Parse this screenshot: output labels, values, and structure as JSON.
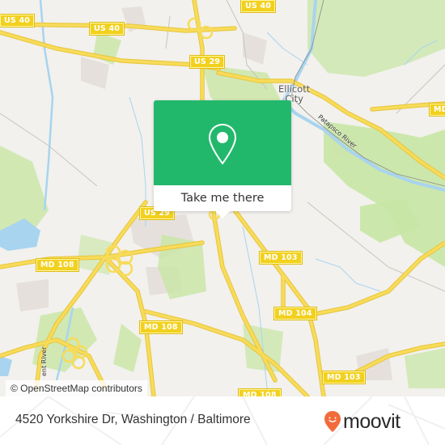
{
  "map": {
    "attribution": "© OpenStreetMap contributors",
    "place_labels": [
      {
        "id": "ellicott-city",
        "line1": "Ellicott",
        "line2": "City"
      }
    ],
    "river_labels": [
      {
        "id": "patapsco-river",
        "text": "Patapsco River"
      },
      {
        "id": "patuxent-river",
        "text": "ent River"
      }
    ],
    "road_shields": [
      {
        "id": "us40-a",
        "text": "US 40"
      },
      {
        "id": "us40-b",
        "text": "US 40"
      },
      {
        "id": "us40-c",
        "text": "US 40"
      },
      {
        "id": "us29-a",
        "text": "US 29"
      },
      {
        "id": "us29-b",
        "text": "US 29"
      },
      {
        "id": "md108-a",
        "text": "MD 108"
      },
      {
        "id": "md108-b",
        "text": "MD 108"
      },
      {
        "id": "md108-c",
        "text": "MD 108"
      },
      {
        "id": "md103-a",
        "text": "MD 103"
      },
      {
        "id": "md103-b",
        "text": "MD 103"
      },
      {
        "id": "md104",
        "text": "MD 104"
      },
      {
        "id": "md-edge",
        "text": "MD"
      }
    ],
    "colors": {
      "background": "#f2f1ed",
      "park": "#c8e6a4",
      "water": "#a8d4ef",
      "road": "#f7db5a",
      "residential": "#e6e0dd"
    }
  },
  "popup": {
    "action_label": "Take me there",
    "icon": "map-pin-icon",
    "color": "#22b86c"
  },
  "footer": {
    "address": "4520 Yorkshire Dr, Washington / Baltimore",
    "brand": "moovit",
    "brand_color": "#f26b3a"
  }
}
